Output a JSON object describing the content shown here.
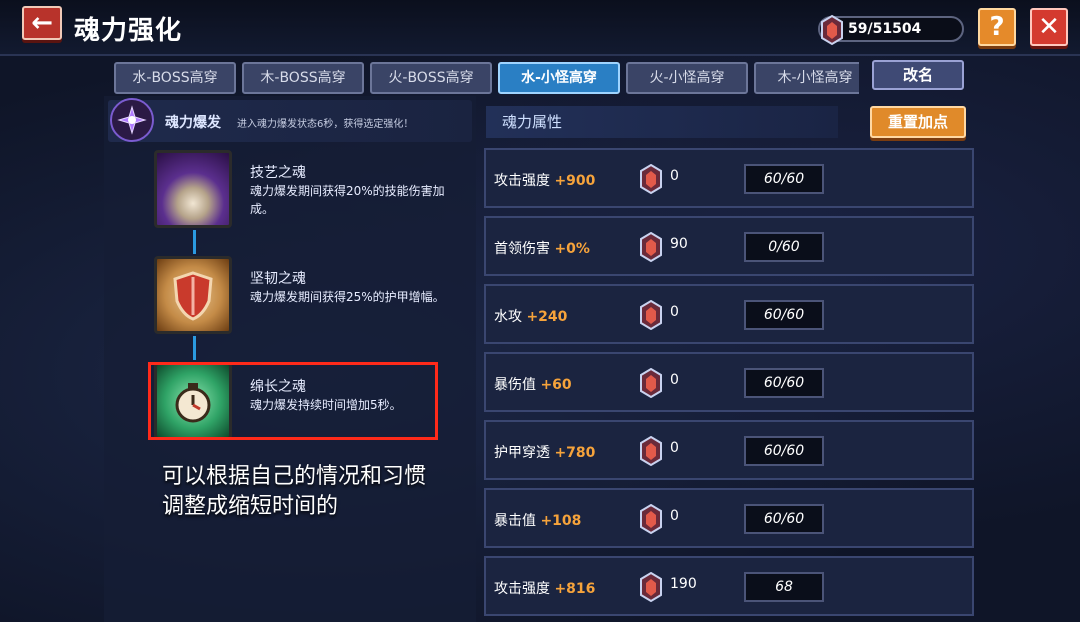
{
  "header": {
    "title": "魂力强化",
    "currency": "59/51504",
    "help_label": "?",
    "close_label": "✕",
    "back_icon": "arrow-left-icon"
  },
  "tabs": [
    {
      "label": "水-BOSS高穿",
      "active": false
    },
    {
      "label": "木-BOSS高穿",
      "active": false
    },
    {
      "label": "火-BOSS高穿",
      "active": false
    },
    {
      "label": "水-小怪高穿",
      "active": true
    },
    {
      "label": "火-小怪高穿",
      "active": false
    },
    {
      "label": "木-小怪高穿",
      "active": false
    }
  ],
  "rename_label": "改名",
  "skill": {
    "name": "魂力爆发",
    "description": "进入魂力爆发状态6秒，获得选定强化！"
  },
  "souls": [
    {
      "name": "技艺之魂",
      "desc": "魂力爆发期间获得20%的技能伤害加成。"
    },
    {
      "name": "坚韧之魂",
      "desc": "魂力爆发期间获得25%的护甲增幅。"
    },
    {
      "name": "绵长之魂",
      "desc": "魂力爆发持续时间增加5秒。"
    }
  ],
  "caption": {
    "line1": "可以根据自己的情况和习惯",
    "line2": "调整成缩短时间的"
  },
  "attributes_header": "魂力属性",
  "reset_label": "重置加点",
  "attributes": [
    {
      "name": "攻击强度",
      "bonus": "+900",
      "cost": "0",
      "level": "60/60"
    },
    {
      "name": "首领伤害",
      "bonus": "+0%",
      "cost": "90",
      "level": "0/60"
    },
    {
      "name": "水攻",
      "bonus": "+240",
      "cost": "0",
      "level": "60/60"
    },
    {
      "name": "暴伤值",
      "bonus": "+60",
      "cost": "0",
      "level": "60/60"
    },
    {
      "name": "护甲穿透",
      "bonus": "+780",
      "cost": "0",
      "level": "60/60"
    },
    {
      "name": "暴击值",
      "bonus": "+108",
      "cost": "0",
      "level": "60/60"
    },
    {
      "name": "攻击强度",
      "bonus": "+816",
      "cost": "190",
      "level": "68"
    }
  ],
  "colors": {
    "accent_tab": "#2a7fc4",
    "bonus_orange": "#f6a33b",
    "highlight_red": "#ff2a1a"
  }
}
